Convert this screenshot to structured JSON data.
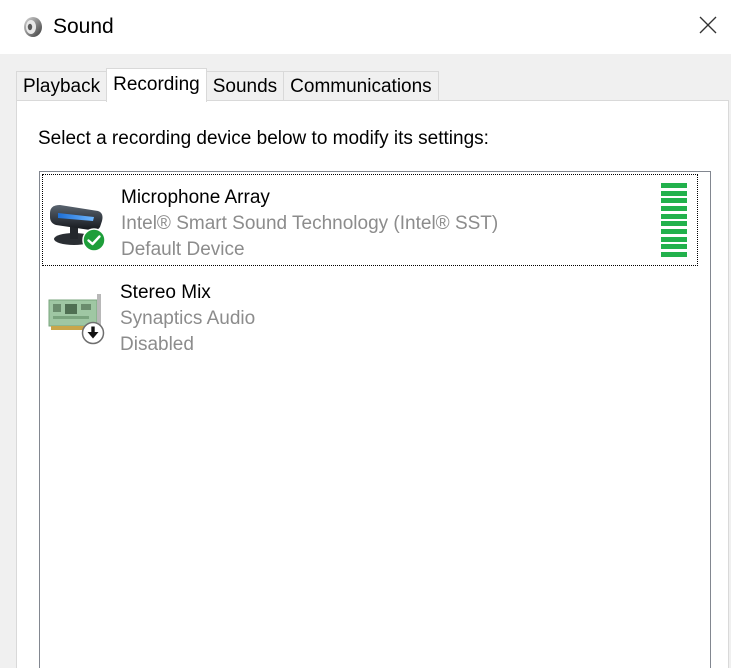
{
  "window": {
    "title": "Sound",
    "icon": "speaker-icon",
    "close_icon": "close-icon"
  },
  "tabs": [
    {
      "label": "Playback",
      "active": false
    },
    {
      "label": "Recording",
      "active": true
    },
    {
      "label": "Sounds",
      "active": false
    },
    {
      "label": "Communications",
      "active": false
    }
  ],
  "recording": {
    "instruction": "Select a recording device below to modify its settings:",
    "devices": [
      {
        "name": "Microphone Array",
        "description": "Intel® Smart Sound Technology (Intel® SST)",
        "status": "Default Device",
        "icon": "microphone-icon",
        "badge": "default-check-icon",
        "selected": true,
        "level": 1.0
      },
      {
        "name": "Stereo Mix",
        "description": "Synaptics Audio",
        "status": "Disabled",
        "icon": "sound-card-icon",
        "badge": "disabled-arrow-icon",
        "selected": false
      }
    ]
  },
  "colors": {
    "level_fill": "#22b14c",
    "check_badge": "#1e9e3a",
    "secondary_text": "#8c8c8c",
    "list_border": "#828790",
    "dialog_bg": "#f0f0f0"
  }
}
